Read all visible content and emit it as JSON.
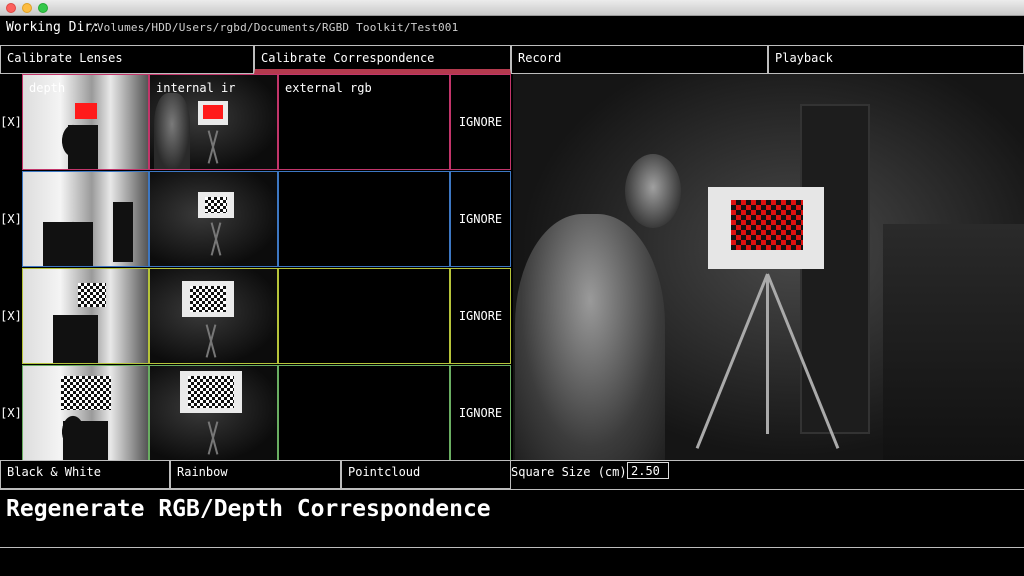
{
  "working_dir": {
    "label": "Working Dir:",
    "path": "/Volumes/HDD/Users/rgbd/Documents/RGBD Toolkit/Test001"
  },
  "tabs": [
    {
      "label": "Calibrate Lenses",
      "active": false
    },
    {
      "label": "Calibrate Correspondence",
      "active": true
    },
    {
      "label": "Record",
      "active": false
    },
    {
      "label": "Playback",
      "active": false
    }
  ],
  "columns": {
    "depth": "depth",
    "internal_ir": "internal ir",
    "external_rgb": "external rgb"
  },
  "rows": [
    {
      "checkbox": "[X]",
      "ignore": "IGNORE",
      "color": "#c2356a"
    },
    {
      "checkbox": "[X]",
      "ignore": "IGNORE",
      "color": "#3d77c2"
    },
    {
      "checkbox": "[X]",
      "ignore": "IGNORE",
      "color": "#b6c43a"
    },
    {
      "checkbox": "[X]",
      "ignore": "IGNORE",
      "color": "#6aae62"
    }
  ],
  "modes": [
    {
      "label": "Black & White"
    },
    {
      "label": "Rainbow"
    },
    {
      "label": "Pointcloud"
    }
  ],
  "square_size": {
    "label": "Square Size (cm)",
    "value": "2.50"
  },
  "regenerate": {
    "label": "Regenerate RGB/Depth Correspondence"
  },
  "colors": {
    "active_tab_accent": "#b43a4e",
    "border": "#bdbdbd",
    "marker_red": "#ff1a1a"
  }
}
